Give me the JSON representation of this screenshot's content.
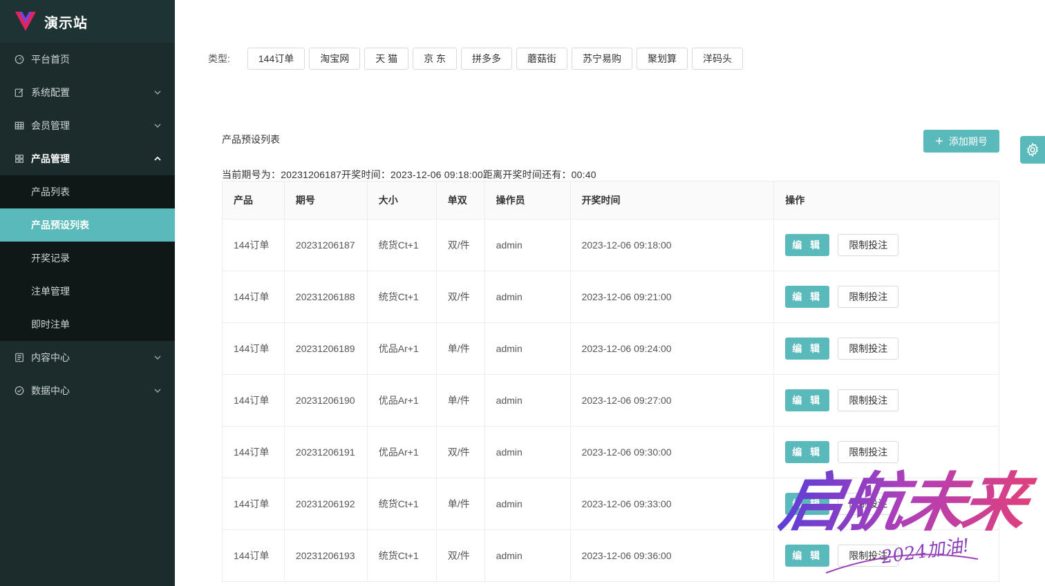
{
  "brand": {
    "title": "演示站"
  },
  "sidebar": {
    "items": [
      {
        "label": "平台首页",
        "icon": "dashboard-icon",
        "has_children": false
      },
      {
        "label": "系统配置",
        "icon": "edit-icon",
        "has_children": true
      },
      {
        "label": "会员管理",
        "icon": "table-icon",
        "has_children": true
      },
      {
        "label": "产品管理",
        "icon": "grid-icon",
        "has_children": true,
        "open": true
      },
      {
        "label": "内容中心",
        "icon": "document-icon",
        "has_children": true
      },
      {
        "label": "数据中心",
        "icon": "check-circle-icon",
        "has_children": true
      }
    ],
    "sub_items": [
      {
        "label": "产品列表",
        "active": false
      },
      {
        "label": "产品预设列表",
        "active": true
      },
      {
        "label": "开奖记录",
        "active": false
      },
      {
        "label": "注单管理",
        "active": false
      },
      {
        "label": "即时注单",
        "active": false
      }
    ]
  },
  "filter": {
    "label": "类型:",
    "types": [
      "144订单",
      "淘宝网",
      "天 猫",
      "京 东",
      "拼多多",
      "蘑菇街",
      "苏宁易购",
      "聚划算",
      "洋码头"
    ]
  },
  "section_title": "产品预设列表",
  "add_button": "添加期号",
  "period_info": "当前期号为：20231206187开奖时间：2023-12-06 09:18:00距离开奖时间还有：00:40",
  "table": {
    "headers": [
      "产品",
      "期号",
      "大小",
      "单双",
      "操作员",
      "开奖时间",
      "操作"
    ],
    "edit_label": "编 辑",
    "limit_label": "限制投注",
    "rows": [
      [
        "144订单",
        "20231206187",
        "统货Ct+1",
        "双/件",
        "admin",
        "2023-12-06 09:18:00"
      ],
      [
        "144订单",
        "20231206188",
        "统货Ct+1",
        "双/件",
        "admin",
        "2023-12-06 09:21:00"
      ],
      [
        "144订单",
        "20231206189",
        "优品Ar+1",
        "单/件",
        "admin",
        "2023-12-06 09:24:00"
      ],
      [
        "144订单",
        "20231206190",
        "优品Ar+1",
        "单/件",
        "admin",
        "2023-12-06 09:27:00"
      ],
      [
        "144订单",
        "20231206191",
        "优品Ar+1",
        "双/件",
        "admin",
        "2023-12-06 09:30:00"
      ],
      [
        "144订单",
        "20231206192",
        "统货Ct+1",
        "单/件",
        "admin",
        "2023-12-06 09:33:00"
      ],
      [
        "144订单",
        "20231206193",
        "统货Ct+1",
        "双/件",
        "admin",
        "2023-12-06 09:36:00"
      ]
    ]
  },
  "watermark": {
    "main": "启航未来",
    "sub": "2024加油!"
  },
  "colors": {
    "accent": "#5ab9bb",
    "sidebar_bg": "#1c2b2b",
    "submenu_bg": "#0f1717"
  }
}
